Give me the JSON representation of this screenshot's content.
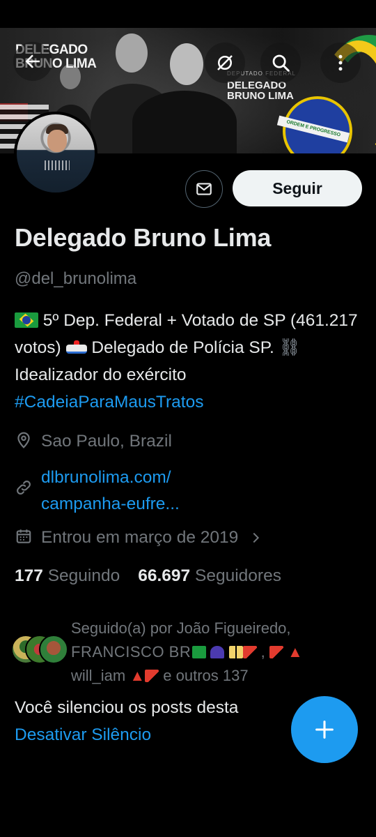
{
  "header": {
    "banner_brand_left": "DELEGADO\nBRUNO LIMA",
    "banner_brand_mid_small": "DEPUTADO FEDERAL",
    "banner_brand_mid": "DELEGADO\nBRUNO LIMA",
    "banner_flag_motto": "ORDEM E PROGRESSO",
    "back_icon": "arrow-left-icon",
    "mute_icon": "bell-slash-icon",
    "search_icon": "search-icon",
    "more_icon": "more-vertical-icon"
  },
  "profile": {
    "name": "Delegado Bruno Lima",
    "handle": "@del_brunolima",
    "follow_label": "Seguir",
    "message_icon": "envelope-icon",
    "bio": {
      "part1": " 5º Dep. Federal + Votado de SP (461.217 votos) ",
      "part2": " Delegado de Polícia SP. ",
      "chain": "⛓",
      "part3": " Idealizador do exército ",
      "hashtag": "#CadeiaParaMausTratos"
    },
    "location": "Sao Paulo, Brazil",
    "website_line1": "dlbrunolima.com/",
    "website_line2": "campanha-eufre...",
    "joined": "Entrou em março de 2019",
    "following_count": "177",
    "following_label": "Seguindo",
    "followers_count": "66.697",
    "followers_label": "Seguidores"
  },
  "followed_by": {
    "line1": "Seguido(a) por João Figueiredo,",
    "name2": "FRANCISCO BR",
    "name3": "will_iam",
    "suffix": " e outros 137"
  },
  "muted": {
    "text": "Você silenciou os posts desta",
    "unmute": "Desativar Silêncio"
  },
  "fab": {
    "icon": "plus-icon"
  },
  "colors": {
    "accent": "#1d9bf0",
    "background": "#000000",
    "secondary_text": "#71767b"
  }
}
